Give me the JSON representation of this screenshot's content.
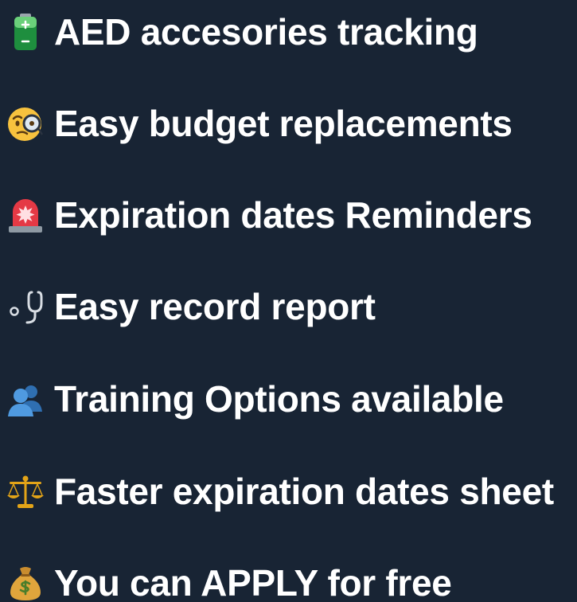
{
  "features": [
    {
      "icon": "battery-icon",
      "label": "AED accesories tracking"
    },
    {
      "icon": "face-with-monocle-icon",
      "label": "Easy budget replacements"
    },
    {
      "icon": "police-light-icon",
      "label": "Expiration dates Reminders"
    },
    {
      "icon": "stethoscope-icon",
      "label": "Easy record report"
    },
    {
      "icon": "busts-in-silhouette-icon",
      "label": "Training Options available"
    },
    {
      "icon": "balance-scale-icon",
      "label": "Faster expiration dates sheet"
    },
    {
      "icon": "money-bag-icon",
      "label": "You can APPLY for free"
    }
  ],
  "colors": {
    "background": "#182434",
    "text": "#ffffff"
  }
}
